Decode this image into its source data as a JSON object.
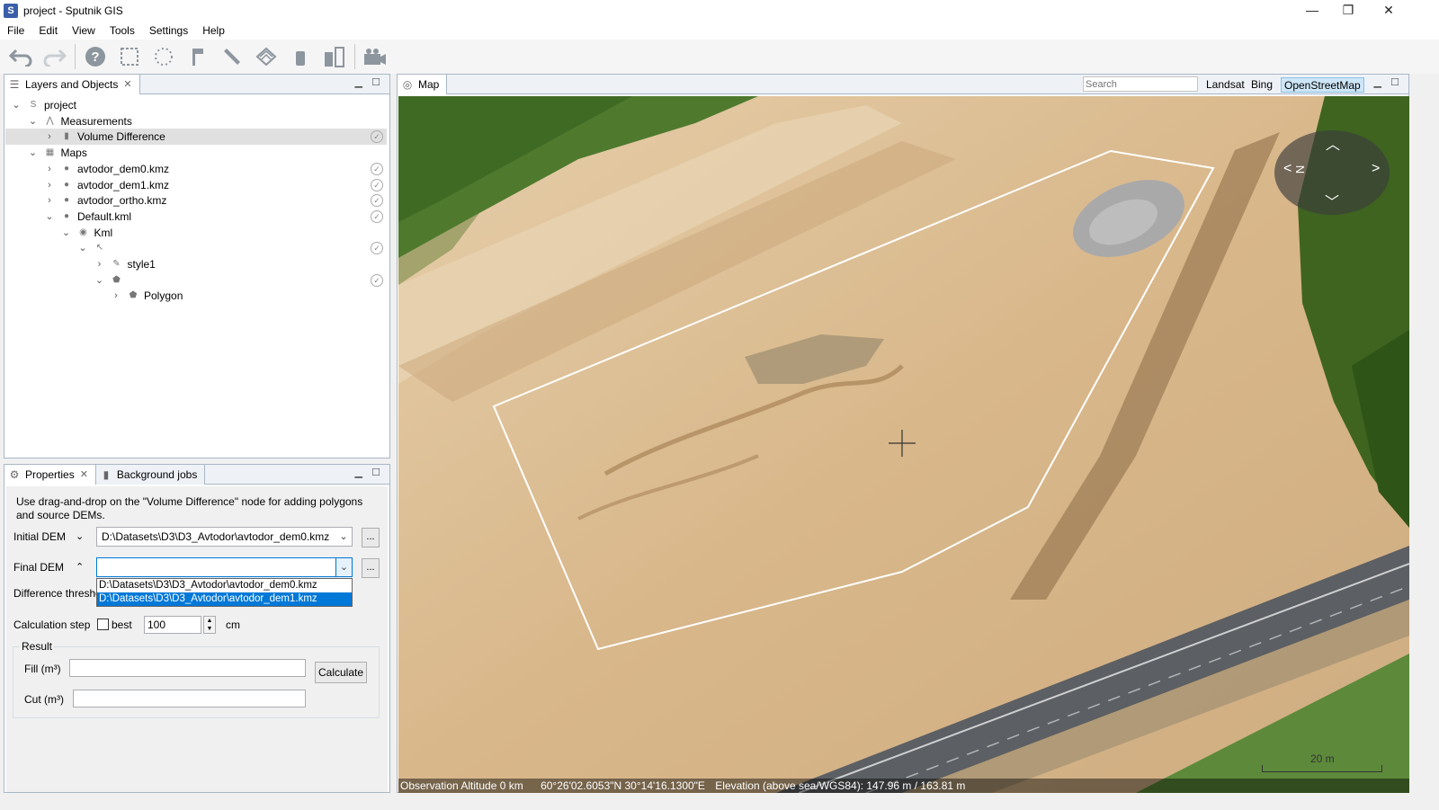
{
  "window": {
    "title": "project - Sputnik GIS",
    "app_icon_letter": "S",
    "controls": {
      "minimize": "—",
      "maximize": "❐",
      "close": "✕"
    }
  },
  "menu": [
    "File",
    "Edit",
    "View",
    "Tools",
    "Settings",
    "Help"
  ],
  "toolbar_icons": [
    "undo-icon",
    "redo-icon",
    "help-icon",
    "select-rect-icon",
    "select-lasso-icon",
    "flag-icon",
    "ruler-icon",
    "polygon-icon",
    "cylinder-icon",
    "volume-icon",
    "camera-icon"
  ],
  "layers_panel": {
    "tab_label": "Layers and Objects",
    "tree": [
      {
        "label": "project",
        "icon": "S",
        "level": 0,
        "expanded": true,
        "vis": false
      },
      {
        "label": "Measurements",
        "level": 1,
        "expanded": true,
        "vis": false
      },
      {
        "label": "Volume Difference",
        "level": 2,
        "expanded": false,
        "vis": true,
        "selected": true
      },
      {
        "label": "Maps",
        "level": 1,
        "expanded": true,
        "vis": false
      },
      {
        "label": "avtodor_dem0.kmz",
        "level": 2,
        "expanded": false,
        "vis": true
      },
      {
        "label": "avtodor_dem1.kmz",
        "level": 2,
        "expanded": false,
        "vis": true
      },
      {
        "label": "avtodor_ortho.kmz",
        "level": 2,
        "expanded": false,
        "vis": true
      },
      {
        "label": "Default.kml",
        "level": 2,
        "expanded": true,
        "vis": true
      },
      {
        "label": "Kml",
        "level": 3,
        "expanded": true,
        "vis": false
      },
      {
        "label": "",
        "level": 4,
        "expanded": true,
        "vis": true
      },
      {
        "label": "style1",
        "level": 5,
        "expanded": false,
        "vis": false
      },
      {
        "label": "",
        "level": 5,
        "expanded": true,
        "vis": true
      },
      {
        "label": "Polygon",
        "level": 6,
        "expanded": false,
        "vis": false
      }
    ]
  },
  "properties_panel": {
    "tab_label": "Properties",
    "tab2_label": "Background jobs",
    "hint_line1": "Use drag-and-drop on the \"Volume Difference\" node for adding polygons",
    "hint_line2": "and source DEMs.",
    "initial_dem_label": "Initial DEM",
    "initial_dem_value": "D:\\Datasets\\D3\\D3_Avtodor\\avtodor_dem0.kmz",
    "final_dem_label": "Final DEM",
    "final_dem_value": "",
    "dropdown_options": [
      "D:\\Datasets\\D3\\D3_Avtodor\\avtodor_dem0.kmz",
      "D:\\Datasets\\D3\\D3_Avtodor\\avtodor_dem1.kmz"
    ],
    "dropdown_selected": "D:\\Datasets\\D3\\D3_Avtodor\\avtodor_dem1.kmz",
    "difference_label": "Difference thresho",
    "calc_step_label": "Calculation step",
    "best_label": "best",
    "best_checked": false,
    "step_value": "100",
    "step_unit": "cm",
    "result_label": "Result",
    "fill_label": "Fill (m³)",
    "cut_label": "Cut (m³)",
    "fill_value": "",
    "cut_value": "",
    "calculate_label": "Calculate",
    "browse_label": "..."
  },
  "map_panel": {
    "tab_label": "Map",
    "search_placeholder": "Search",
    "basemaps": [
      "Landsat",
      "Bing",
      "OpenStreetMap"
    ],
    "active_basemap": "OpenStreetMap",
    "scale_label": "20 m",
    "status": {
      "altitude": "Observation Altitude 0 km",
      "coords": "60°26'02.6053\"N 30°14'16.1300\"E",
      "elevation": "Elevation (above sea/WGS84): 147.96 m / 163.81 m"
    },
    "compass_letter": "N"
  },
  "colors": {
    "accent": "#0078d7",
    "selection": "#e0e0e0",
    "border": "#a9b7c6",
    "sand": "#d9b98d",
    "grass": "#4f7a2e"
  }
}
